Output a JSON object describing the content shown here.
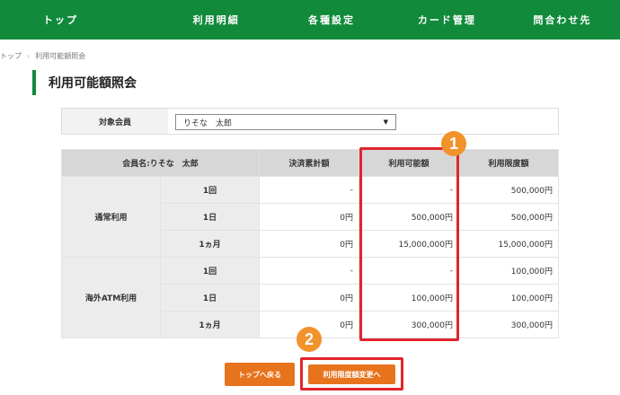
{
  "nav": {
    "items": [
      {
        "label": "トップ"
      },
      {
        "label": "利用明細"
      },
      {
        "label": "各種設定"
      },
      {
        "label": "カード管理"
      },
      {
        "label": "問合わせ先"
      }
    ],
    "color": "#118a3c"
  },
  "breadcrumb": {
    "home": "トップ",
    "current": "利用可能額照会"
  },
  "page_title": "利用可能額照会",
  "member_select": {
    "label": "対象会員",
    "value": "りそな　太郎"
  },
  "table": {
    "headers": [
      "会員名:りそな　太郎",
      "決済累計額",
      "利用可能額",
      "利用限度額"
    ],
    "groups": [
      {
        "name": "通常利用",
        "rows": [
          {
            "period": "1回",
            "cumulative": "-",
            "available": "-",
            "limit": "500,000円"
          },
          {
            "period": "1日",
            "cumulative": "0円",
            "available": "500,000円",
            "limit": "500,000円"
          },
          {
            "period": "1ヵ月",
            "cumulative": "0円",
            "available": "15,000,000円",
            "limit": "15,000,000円"
          }
        ]
      },
      {
        "name": "海外ATM利用",
        "rows": [
          {
            "period": "1回",
            "cumulative": "-",
            "available": "-",
            "limit": "100,000円"
          },
          {
            "period": "1日",
            "cumulative": "0円",
            "available": "100,000円",
            "limit": "100,000円"
          },
          {
            "period": "1ヵ月",
            "cumulative": "0円",
            "available": "300,000円",
            "limit": "300,000円"
          }
        ]
      }
    ]
  },
  "annotations": {
    "badge1": "1",
    "badge2": "2",
    "badge_color": "#f1932a",
    "highlight_color": "#e0252c"
  },
  "buttons": {
    "back": "トップへ戻る",
    "change_limit": "利用限度額変更へ",
    "color": "#e8731d"
  }
}
